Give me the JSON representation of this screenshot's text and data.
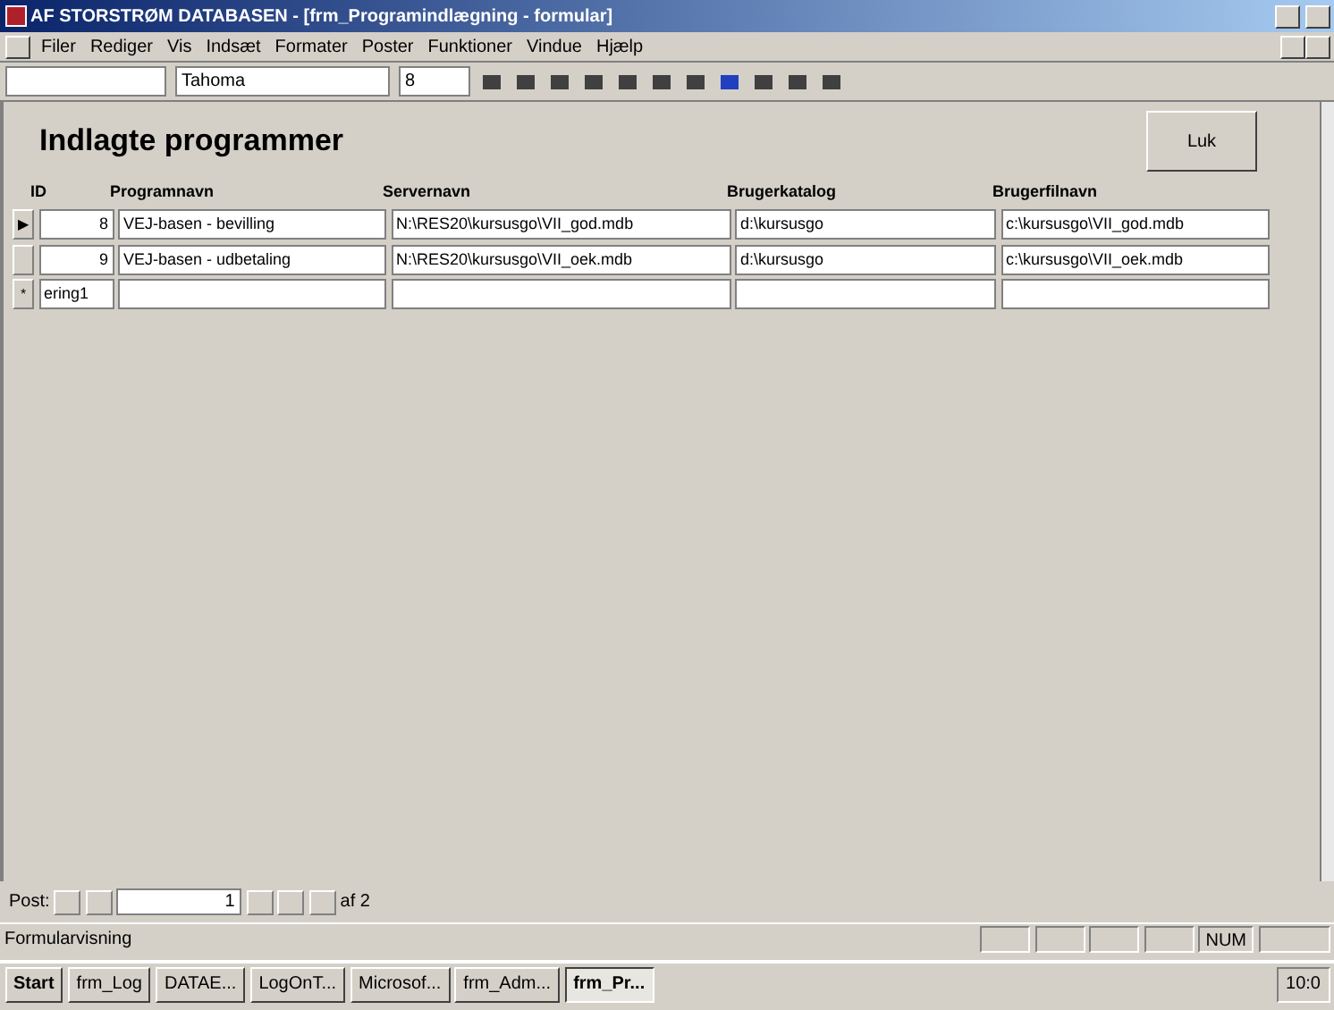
{
  "window": {
    "title": "AF STORSTRØM DATABASEN - [frm_Programindlægning - formular]"
  },
  "menu": [
    "Filer",
    "Rediger",
    "Vis",
    "Indsæt",
    "Formater",
    "Poster",
    "Funktioner",
    "Vindue",
    "Hjælp"
  ],
  "toolbar": {
    "font": "Tahoma",
    "size": "8"
  },
  "form": {
    "title": "Indlagte programmer",
    "close_button": "Luk"
  },
  "columns": [
    "ID",
    "Programnavn",
    "Servernavn",
    "Brugerkatalog",
    "Brugerfilnavn"
  ],
  "rows": [
    {
      "kind": "record",
      "marker": "▶",
      "cells": [
        "8",
        "VEJ-basen - bevilling",
        "N:\\RES20\\kursusgo\\VII_god.mdb",
        "d:\\kursusgo",
        "c:\\kursusgo\\VII_god.mdb"
      ]
    },
    {
      "kind": "record",
      "cells": [
        "9",
        "VEJ-basen - udbetaling",
        "N:\\RES20\\kursusgo\\VII_oek.mdb",
        "d:\\kursusgo",
        "c:\\kursusgo\\VII_oek.mdb"
      ]
    },
    {
      "kind": "new",
      "marker": "*",
      "cells": [
        "ering1",
        "",
        "",
        "",
        ""
      ]
    }
  ],
  "navigation": {
    "label": "Post:",
    "record": "1",
    "count": "af 2"
  },
  "status_bar": {
    "text": "Formularvisning",
    "indicator": "NUM"
  },
  "taskbar": {
    "start": "Start",
    "tasks": [
      {
        "label": "frm_Log",
        "selected": false
      },
      {
        "label": "DATAE...",
        "selected": false
      },
      {
        "label": "LogOnT...",
        "selected": false
      },
      {
        "label": "Microsof...",
        "selected": false
      },
      {
        "label": "frm_Adm...",
        "selected": false
      },
      {
        "label": "frm_Pr...",
        "selected": true
      }
    ],
    "clock": "10:0"
  }
}
